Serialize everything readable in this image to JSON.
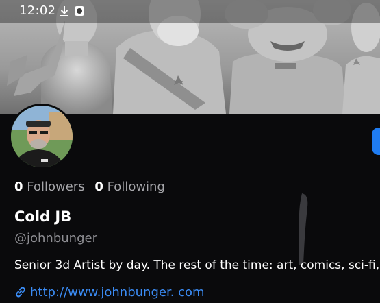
{
  "status_bar": {
    "time": "12:02",
    "icons": [
      "download-icon",
      "app-notification-icon"
    ]
  },
  "banner": {
    "description_icon": "sculpture-banner-image"
  },
  "profile": {
    "avatar_icon": "avatar-photo",
    "followers_count": "0",
    "followers_label": "Followers",
    "following_count": "0",
    "following_label": "Following",
    "display_name": "Cold JB",
    "handle": "@johnbunger",
    "bio": "Senior 3d Artist by day. The rest of the time: art, comics, sci-fi,",
    "link_icon": "link-icon",
    "link_text": "http://www.johnbunger. com"
  },
  "colors": {
    "background": "#0a0a0c",
    "accent_blue": "#1f7cf2",
    "link_blue": "#3b8cf5",
    "secondary_text": "#a6a6aa"
  }
}
